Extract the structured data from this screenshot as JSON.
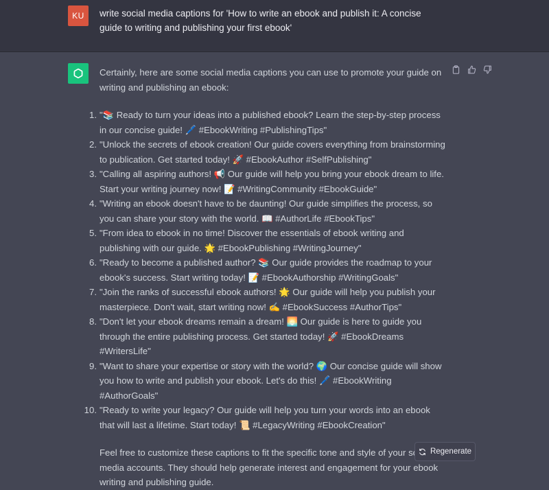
{
  "user_message": {
    "avatar_initials": "KU",
    "text": "write social media captions for 'How to write an ebook and publish it: A concise guide to writing and publishing your first ebook'"
  },
  "assistant_message": {
    "avatar_icon": "openai-logo-icon",
    "intro": "Certainly, here are some social media captions you can use to promote your guide on writing and publishing an ebook:",
    "captions": [
      {
        "number": "1.",
        "text": "\"📚 Ready to turn your ideas into a published ebook? Learn the step-by-step process in our concise guide! 🖊️ #EbookWriting #PublishingTips\""
      },
      {
        "number": "2.",
        "text": "\"Unlock the secrets of ebook creation! Our guide covers everything from brainstorming to publication. Get started today! 🚀 #EbookAuthor #SelfPublishing\""
      },
      {
        "number": "3.",
        "text": "\"Calling all aspiring authors! 📢 Our guide will help you bring your ebook dream to life. Start your writing journey now! 📝 #WritingCommunity #EbookGuide\""
      },
      {
        "number": "4.",
        "text": "\"Writing an ebook doesn't have to be daunting! Our guide simplifies the process, so you can share your story with the world. 📖 #AuthorLife #EbookTips\""
      },
      {
        "number": "5.",
        "text": "\"From idea to ebook in no time! Discover the essentials of ebook writing and publishing with our guide. 🌟 #EbookPublishing #WritingJourney\""
      },
      {
        "number": "6.",
        "text": "\"Ready to become a published author? 📚 Our guide provides the roadmap to your ebook's success. Start writing today! 📝 #EbookAuthorship #WritingGoals\""
      },
      {
        "number": "7.",
        "text": "\"Join the ranks of successful ebook authors! 🌟 Our guide will help you publish your masterpiece. Don't wait, start writing now! ✍️ #EbookSuccess #AuthorTips\""
      },
      {
        "number": "8.",
        "text": "\"Don't let your ebook dreams remain a dream! 🌅 Our guide is here to guide you through the entire publishing process. Get started today! 🚀 #EbookDreams #WritersLife\""
      },
      {
        "number": "9.",
        "text": "\"Want to share your expertise or story with the world? 🌍 Our concise guide will show you how to write and publish your ebook. Let's do this! 🖊️ #EbookWriting #AuthorGoals\""
      },
      {
        "number": "10.",
        "text": "\"Ready to write your legacy? Our guide will help you turn your words into an ebook that will last a lifetime. Start today! 📜 #LegacyWriting #EbookCreation\""
      }
    ],
    "outro": "Feel free to customize these captions to fit the specific tone and style of your social media accounts. They should help generate interest and engagement for your ebook writing and publishing guide."
  },
  "actions": {
    "copy_icon": "clipboard-icon",
    "like_icon": "thumbs-up-icon",
    "dislike_icon": "thumbs-down-icon"
  },
  "regenerate": {
    "icon": "refresh-icon",
    "label": "Regenerate"
  },
  "colors": {
    "user_bg": "#343541",
    "assistant_bg": "#444654",
    "user_avatar": "#d9553f",
    "assistant_avatar": "#19c37d"
  }
}
